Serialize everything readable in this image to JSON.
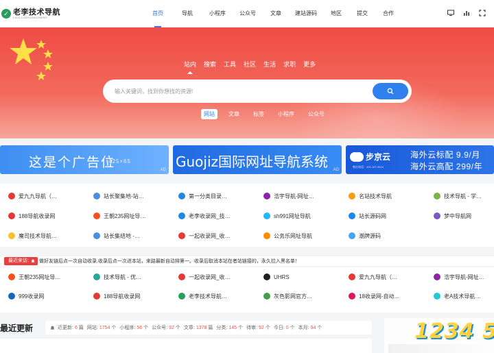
{
  "header": {
    "logo_cn": "老李技术导航",
    "logo_en": "LAOLIJISHUDAOHANG",
    "nav": [
      "首页",
      "导航",
      "小程序",
      "公众号",
      "文章",
      "建站源码",
      "地区",
      "提交",
      "合作"
    ],
    "icons": [
      "monitor-icon",
      "chart-icon",
      "fullscreen-icon"
    ]
  },
  "banner": {
    "scope_tabs": [
      "站内",
      "搜索",
      "工具",
      "社区",
      "生活",
      "求职",
      "更多"
    ],
    "search_placeholder": "输入关键词，找到你想找的资源!",
    "sub_tabs": [
      "网站",
      "文章",
      "标签",
      "小程序",
      "公众号"
    ]
  },
  "ads": {
    "ad1_text": "这是个广告位",
    "ad1_size": "425×65",
    "ad_tag": "AD",
    "ad2_text": "Guojiz国际网址导航系统",
    "ad3_brand": "步京云",
    "ad3_tel": "售后电话：400-187-9516",
    "ad3_line1": "海外云标配  9.9/月",
    "ad3_line2": "海外云高配  299/年"
  },
  "links_top": [
    {
      "label": "爱九九导航（…",
      "color": "#e53935"
    },
    {
      "label": "站长聚集地-站…",
      "color": "#4a90e2"
    },
    {
      "label": "第一分类目录…",
      "color": "#1e88e5"
    },
    {
      "label": "浩宇导航-网址…",
      "color": "#8e24aa"
    },
    {
      "label": "名站技术导航",
      "color": "#f59e0b"
    },
    {
      "label": "技术导航 - 学…",
      "color": "#7cb342"
    },
    {
      "label": "188导航收录网",
      "color": "#e53935"
    },
    {
      "label": "王朝235网址导…",
      "color": "#f4511e"
    },
    {
      "label": "老李收录网_技…",
      "color": "#1e88e5"
    },
    {
      "label": "sh991网址导航",
      "color": "#29b6f6"
    },
    {
      "label": "站长源码网",
      "color": "#1e88e5"
    },
    {
      "label": "梦中导航网",
      "color": "#7e57c2"
    },
    {
      "label": "魔司技术导航…",
      "color": "#fbc02d"
    },
    {
      "label": "站长集结地 -…",
      "color": "#4a90e2"
    },
    {
      "label": "一起收录网_收…",
      "color": "#e53935"
    },
    {
      "label": "公务乐网址导航",
      "color": "#fb8c00"
    },
    {
      "label": "潮牌源码",
      "color": "#42a5f5"
    }
  ],
  "notice": {
    "label": "最近来访:",
    "text": "做好友链后点一次自动收录,收录后点一次进本站，来路最新自动排第一。收录后取消本站在者站链接的，永久拉入黑名单！"
  },
  "links_bottom": [
    {
      "label": "王朝235网址导…",
      "color": "#f4511e"
    },
    {
      "label": "技术导航 - 优…",
      "color": "#26a69a"
    },
    {
      "label": "一起收录网_收…",
      "color": "#e53935"
    },
    {
      "label": "UHRS",
      "color": "#212121"
    },
    {
      "label": "爱九九导航（…",
      "color": "#e53935"
    },
    {
      "label": "浩宇导航-网址…",
      "color": "#8e24aa"
    },
    {
      "label": "999收录网",
      "color": "#1565c0"
    },
    {
      "label": "188导航收录网",
      "color": "#e53935"
    },
    {
      "label": "老李技术导航…",
      "color": "#2a9d5c"
    },
    {
      "label": "灰色影网官方…",
      "color": "#43a047"
    },
    {
      "label": "18收录网-自动…",
      "color": "#d81b60"
    },
    {
      "label": "老A技术导航…",
      "color": "#26c6da"
    }
  ],
  "latest": {
    "title": "最近更新",
    "stats": [
      {
        "k": "近更新:",
        "v": "6",
        "u": "篇"
      },
      {
        "k": "网站:",
        "v": "1754",
        "u": "个"
      },
      {
        "k": "小程序:",
        "v": "56",
        "u": "个"
      },
      {
        "k": "公众号:",
        "v": "92",
        "u": "个"
      },
      {
        "k": "文章:",
        "v": "1378",
        "u": "篇"
      },
      {
        "k": "分类:",
        "v": "145",
        "u": "个"
      },
      {
        "k": "待审:",
        "v": "92",
        "u": "个"
      },
      {
        "k": "今日:",
        "v": "0",
        "u": "个"
      },
      {
        "k": "本月:",
        "v": "94",
        "u": "个"
      }
    ]
  },
  "promo": {
    "digits": "1234 5"
  },
  "colors": {
    "accent": "#3c77e8",
    "banner": "#ee4b43",
    "search_button": "#2f80ed",
    "notice_label": "#e83f3f"
  }
}
